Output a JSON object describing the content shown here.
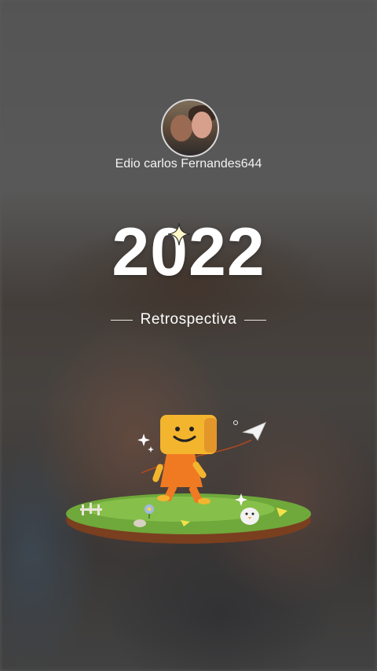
{
  "profile": {
    "username": "Edio carlos Fernandes644",
    "avatar": "profile-photo"
  },
  "hero": {
    "year": "2022",
    "subtitle": "Retrospectiva"
  },
  "illustration": {
    "icons": [
      "sparkle-icon",
      "paper-plane-icon",
      "mascot-character",
      "grass-island",
      "chick-icon",
      "flower-icon"
    ]
  },
  "colors": {
    "mascot_head": "#f4b52e",
    "mascot_body": "#f07a22",
    "grass": "#6fa83b",
    "soil": "#7a3f1f"
  }
}
